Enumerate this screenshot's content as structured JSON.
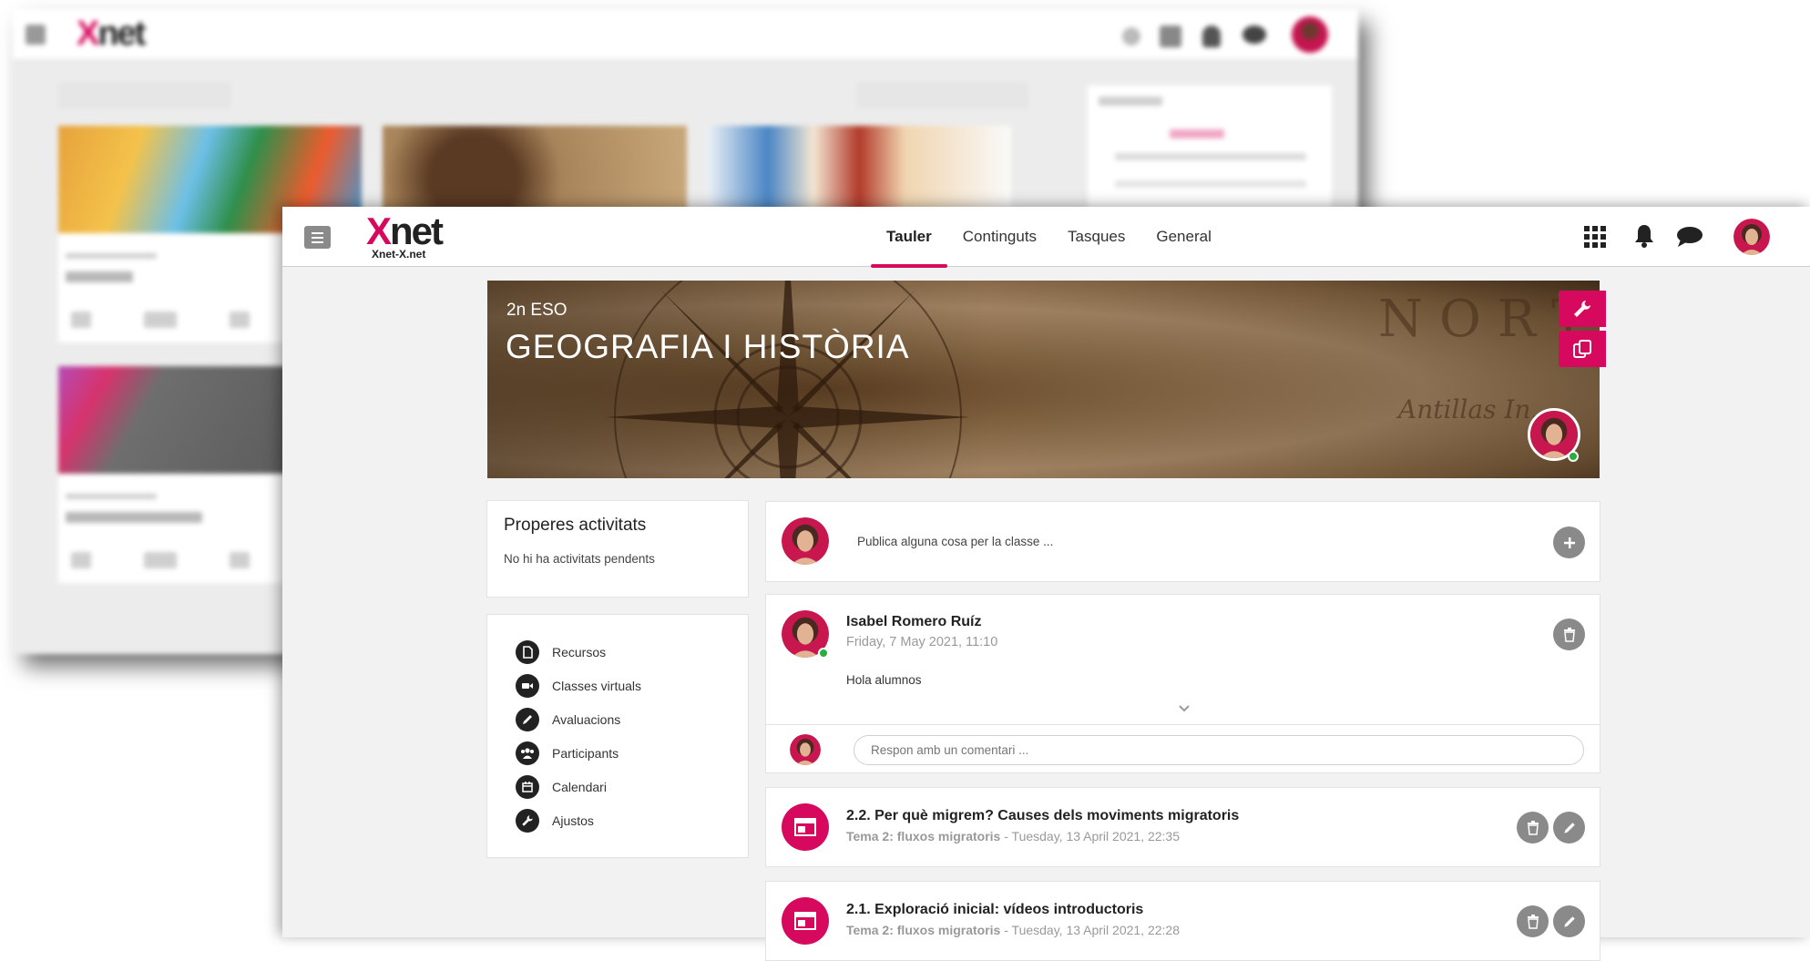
{
  "header": {
    "logo_text": "net",
    "logo_x": "X",
    "logo_sub": "Xnet-X.net",
    "tabs": [
      {
        "label": "Tauler",
        "active": true
      },
      {
        "label": "Continguts",
        "active": false
      },
      {
        "label": "Tasques",
        "active": false
      },
      {
        "label": "General",
        "active": false
      }
    ],
    "icons": [
      "apps-grid-icon",
      "bell-icon",
      "chat-icon"
    ]
  },
  "banner": {
    "grade": "2n ESO",
    "title": "GEOGRAFIA I HISTÒRIA",
    "decor_north": "NORT",
    "decor_place": "Antillas In."
  },
  "upcoming": {
    "title": "Properes activitats",
    "empty_text": "No hi ha activitats pendents"
  },
  "sidebar": {
    "items": [
      {
        "label": "Recursos",
        "icon": "document-icon"
      },
      {
        "label": "Classes virtuals",
        "icon": "video-camera-icon"
      },
      {
        "label": "Avaluacions",
        "icon": "pencil-icon"
      },
      {
        "label": "Participants",
        "icon": "users-icon"
      },
      {
        "label": "Calendari",
        "icon": "calendar-icon"
      },
      {
        "label": "Ajustos",
        "icon": "wrench-icon"
      }
    ]
  },
  "feed": {
    "compose_placeholder": "Publica alguna cosa per la classe ...",
    "post": {
      "author": "Isabel Romero Ruíz",
      "date": "Friday, 7 May 2021, 11:10",
      "body": "Hola alumnos",
      "comment_placeholder": "Respon amb un comentari ..."
    },
    "tasks": [
      {
        "title": "2.2. Per què migrem? Causes dels moviments migratoris",
        "topic": "Tema 2: fluxos migratoris",
        "date": " - Tuesday, 13 April 2021, 22:35"
      },
      {
        "title": "2.1. Exploració inicial: vídeos introductoris",
        "topic": "Tema 2: fluxos migratoris",
        "date": " - Tuesday, 13 April 2021, 22:28"
      }
    ]
  },
  "colors": {
    "accent": "#d6095e",
    "online": "#27ae3c",
    "grey_button": "#8a8a8a"
  }
}
